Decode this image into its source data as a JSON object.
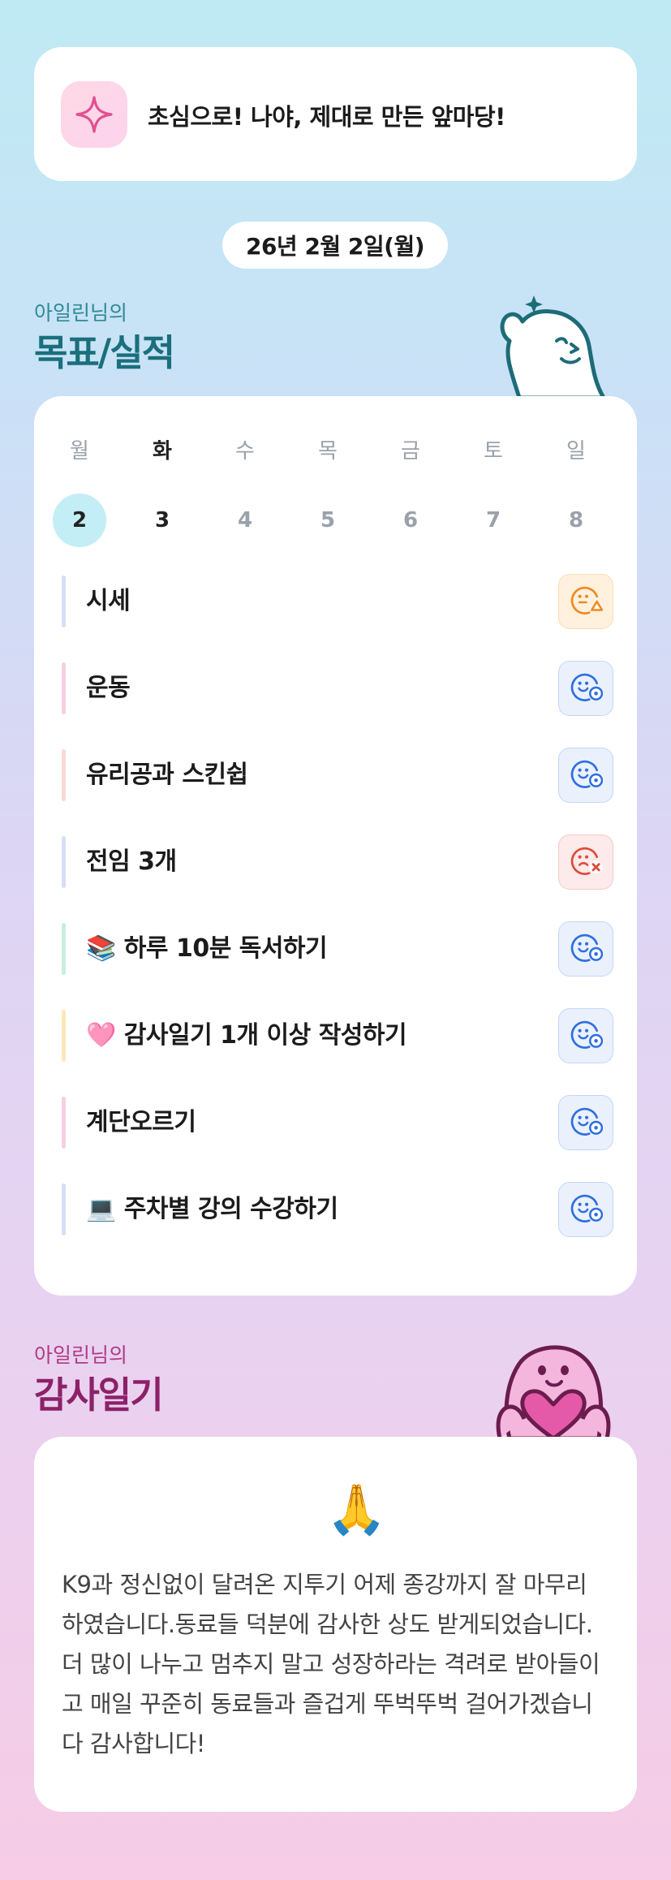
{
  "banner": {
    "text": "초심으로! 나야, 제대로 만든 앞마당!",
    "icon": "sparkle-icon"
  },
  "date": "26년 2월 2일(월)",
  "goals_section": {
    "subtitle": "아일린님의",
    "title": "목표/실적"
  },
  "week": [
    {
      "weekday": "월",
      "day": "2",
      "selected": true,
      "today": false
    },
    {
      "weekday": "화",
      "day": "3",
      "selected": false,
      "today": true
    },
    {
      "weekday": "수",
      "day": "4",
      "selected": false,
      "today": false
    },
    {
      "weekday": "목",
      "day": "5",
      "selected": false,
      "today": false
    },
    {
      "weekday": "금",
      "day": "6",
      "selected": false,
      "today": false
    },
    {
      "weekday": "토",
      "day": "7",
      "selected": false,
      "today": false
    },
    {
      "weekday": "일",
      "day": "8",
      "selected": false,
      "today": false
    }
  ],
  "goals": [
    {
      "label": "시세",
      "bar_color": "#d5def4",
      "status": "partial",
      "status_icon": "face-warning-icon"
    },
    {
      "label": "운동",
      "bar_color": "#f7cfe3",
      "status": "done",
      "status_icon": "face-check-icon"
    },
    {
      "label": "유리공과 스킨쉽",
      "bar_color": "#fbd8d4",
      "status": "done",
      "status_icon": "face-check-icon"
    },
    {
      "label": "전임 3개",
      "bar_color": "#d5def4",
      "status": "failed",
      "status_icon": "face-fail-icon"
    },
    {
      "label": "📚 하루 10분 독서하기",
      "bar_color": "#c9eedd",
      "status": "done",
      "status_icon": "face-check-icon"
    },
    {
      "label": "🩷 감사일기 1개 이상 작성하기",
      "bar_color": "#fbe8b8",
      "status": "done",
      "status_icon": "face-check-icon"
    },
    {
      "label": "계단오르기",
      "bar_color": "#f7cfe3",
      "status": "done",
      "status_icon": "face-check-icon"
    },
    {
      "label": "💻 주차별 강의 수강하기",
      "bar_color": "#d5def4",
      "status": "done",
      "status_icon": "face-check-icon"
    }
  ],
  "gratitude_section": {
    "subtitle": "아일린님의",
    "title": "감사일기"
  },
  "gratitude": {
    "emoji": "🙏",
    "text": "K9과 정신없이 달려온 지투기 어제 종강까지 잘 마무리 하였습니다.동료들 덕분에 감사한 상도 받게되었습니다. 더 많이 나누고 멈추지 말고 성장하라는 격려로 받아들이고 매일 꾸준히 동료들과 즐겁게 뚜벅뚜벅 걸어가겠습니다 감사합니다!"
  },
  "colors": {
    "done": "#2f6fe0",
    "done_bg": "#eaf1fd",
    "partial": "#f08a1e",
    "partial_bg": "#fff1de",
    "failed": "#e04a3a",
    "failed_bg": "#fdeaea"
  }
}
